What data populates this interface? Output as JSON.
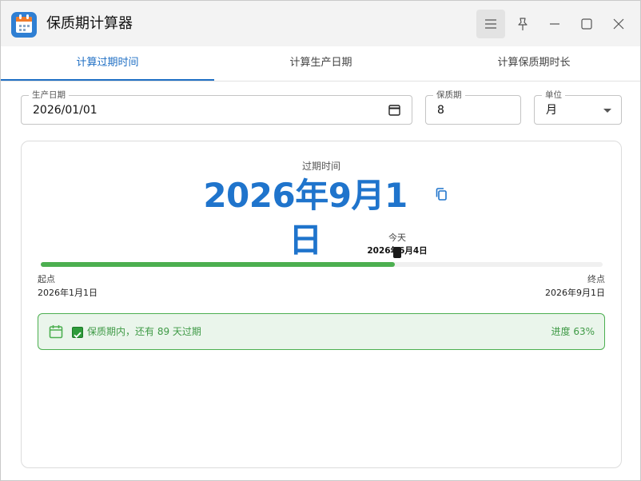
{
  "app": {
    "title": "保质期计算器",
    "icon": "calendar-app-icon"
  },
  "titlebar": {
    "buttons": [
      "menu-icon",
      "pin-icon",
      "minimize-icon",
      "maximize-icon",
      "close-icon"
    ]
  },
  "tabs": [
    {
      "label": "计算过期时间",
      "selected": true
    },
    {
      "label": "计算生产日期",
      "selected": false
    },
    {
      "label": "计算保质期时长",
      "selected": false
    }
  ],
  "form": {
    "production_date": {
      "label": "生产日期",
      "value": "2026/01/01"
    },
    "shelf_life": {
      "label": "保质期",
      "value": "8"
    },
    "unit": {
      "label": "单位",
      "value": "月"
    }
  },
  "result": {
    "label": "过期时间",
    "date": "2026年9月1日"
  },
  "timeline": {
    "today_label": "今天",
    "today_date": "2026年6月4日",
    "start_label": "起点",
    "start_date": "2026年1月1日",
    "end_label": "终点",
    "end_date": "2026年9月1日",
    "progress_fraction": 0.63
  },
  "status": {
    "text": "保质期内，还有 89 天过期",
    "progress": "进度 63%"
  },
  "colors": {
    "accent": "#1f74cc",
    "success": "#4caf50",
    "success_bg": "#eaf5eb"
  }
}
